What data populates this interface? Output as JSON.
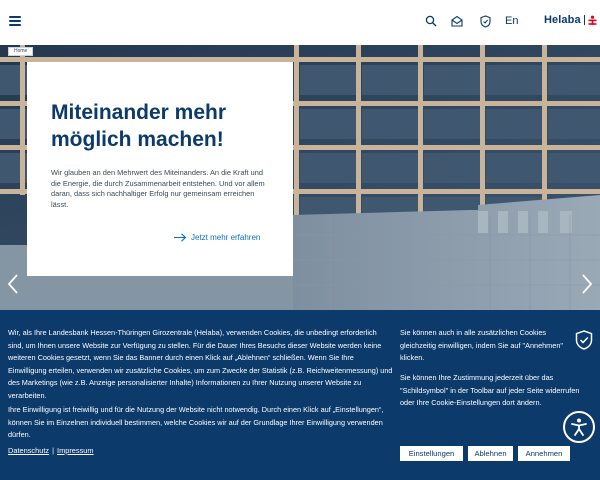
{
  "header": {
    "lang": "En",
    "logo_text": "Helaba"
  },
  "breadcrumb": "Home",
  "hero": {
    "title": "Miteinander mehr möglich machen!",
    "body": "Wir glauben an den Mehrwert des Miteinanders. An die Kraft und die Energie, die durch Zusammenarbeit entstehen. Und vor allem daran, dass sich nachhaltiger Erfolg nur gemeinsam erreichen lässt.",
    "link": "Jetzt mehr erfahren"
  },
  "cookie": {
    "left_p1": "Wir, als Ihre Landesbank Hessen-Thüringen Girozentrale (Helaba), verwenden Cookies, die unbedingt erforderlich sind, um Ihnen unsere Website zur Verfügung zu stellen. Für die Dauer Ihres Besuchs dieser Website werden keine weiteren Cookies gesetzt, wenn Sie das Banner durch einen Klick auf „Ablehnen“ schließen. Wenn Sie Ihre Einwilligung erteilen, verwenden wir zusätzliche Cookies, um zum Zwecke der Statistik (z.B. Reichweitenmessung) und des Marketings (wie z.B. Anzeige personalisierter Inhalte) Informationen zu Ihrer Nutzung unserer Website zu verarbeiten.",
    "left_p2": "Ihre Einwilligung ist freiwillig und für die Nutzung der Website nicht notwendig. Durch einen Klick auf „Einstellungen“, können Sie im Einzelnen individuell bestimmen, welche Cookies wir auf der Grundlage Ihrer Einwilligung verwenden dürfen.",
    "right_p1": "Sie können auch in alle zusätzlichen Cookies gleichzeitig einwilligen, indem Sie auf \"Annehmen\" klicken.",
    "right_p2": "Sie können Ihre Zustimmung jederzeit über das \"Schildsymbol\" in der Toolbar auf jeder Seite widerrufen oder Ihre Cookie-Einstellungen dort ändern.",
    "link_privacy": "Datenschutz",
    "link_sep": "|",
    "link_imprint": "Impressum",
    "btn_settings": "Einstellungen",
    "btn_reject": "Ablehnen",
    "btn_accept": "Annehmen"
  },
  "colors": {
    "brand_blue": "#0b3a6b",
    "link_blue": "#0b6fc7",
    "sparkasse_red": "#e2001a"
  }
}
